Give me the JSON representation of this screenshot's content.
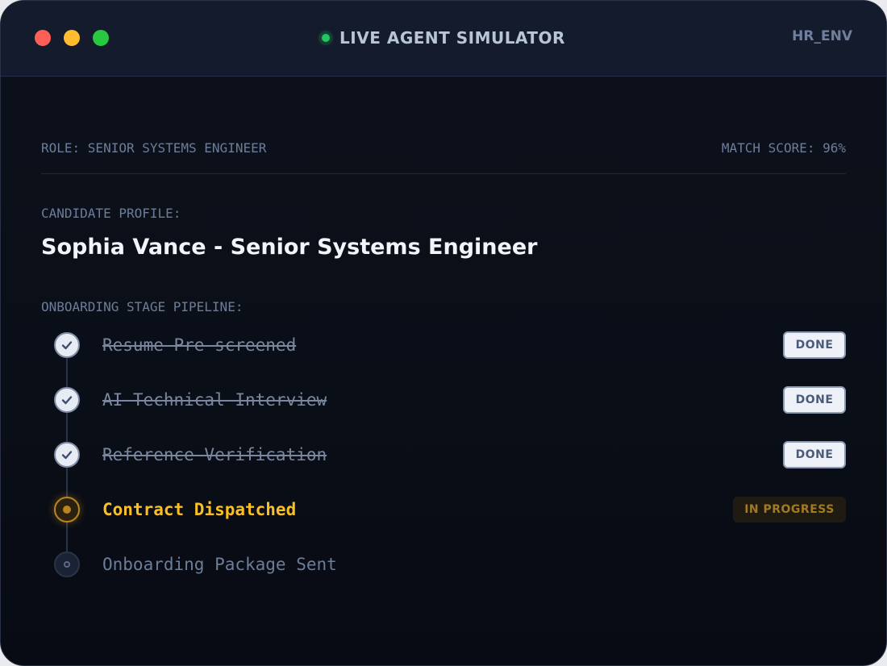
{
  "window": {
    "title": "LIVE AGENT SIMULATOR",
    "env": "HR_ENV"
  },
  "meta": {
    "role": "ROLE: SENIOR SYSTEMS ENGINEER",
    "match_score": "MATCH SCORE: 96%"
  },
  "profile": {
    "label": "CANDIDATE PROFILE:",
    "name": "Sophia Vance - Senior Systems Engineer"
  },
  "pipeline": {
    "label": "ONBOARDING STAGE PIPELINE:",
    "stages": [
      {
        "label": "Resume Pre-screened",
        "status": "done",
        "badge": "DONE"
      },
      {
        "label": "AI Technical Interview",
        "status": "done",
        "badge": "DONE"
      },
      {
        "label": "Reference Verification",
        "status": "done",
        "badge": "DONE"
      },
      {
        "label": "Contract Dispatched",
        "status": "active",
        "badge": "IN PROGRESS"
      },
      {
        "label": "Onboarding Package Sent",
        "status": "pending",
        "badge": ""
      }
    ]
  },
  "colors": {
    "live": "#22c55e",
    "active": "#fbbf24",
    "close": "#fe5f57",
    "minimize": "#febc2e",
    "maximize": "#28c840"
  }
}
